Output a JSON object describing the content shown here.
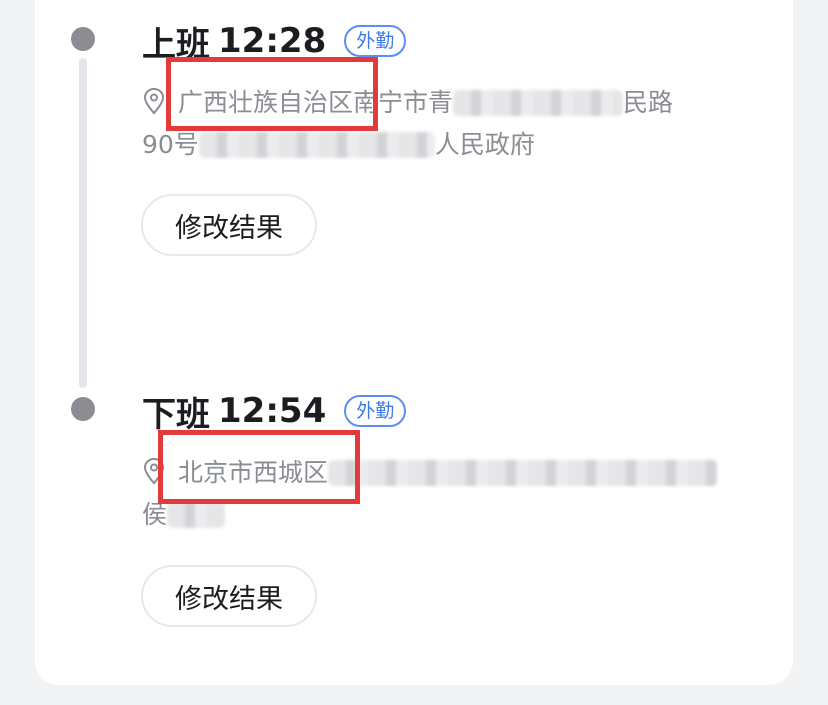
{
  "records": [
    {
      "label": "上班",
      "time": "12:28",
      "badge": "外勤",
      "address_visible": "广西壮族自治区南宁市青",
      "address_tail": "民路",
      "address_line2_start": "90号",
      "address_line2_end": "人民政府",
      "edit_label": "修改结果"
    },
    {
      "label": "下班",
      "time": "12:54",
      "badge": "外勤",
      "address_visible": "北京市西城区",
      "address_line2_start": "侯",
      "edit_label": "修改结果"
    }
  ],
  "icons": {
    "location": "location-pin-icon"
  },
  "colors": {
    "badge": "#3d7bea",
    "highlight": "#e23b3b",
    "dot": "#8b8d93",
    "text_primary": "#1c1d21",
    "text_secondary": "#8a8d94"
  }
}
